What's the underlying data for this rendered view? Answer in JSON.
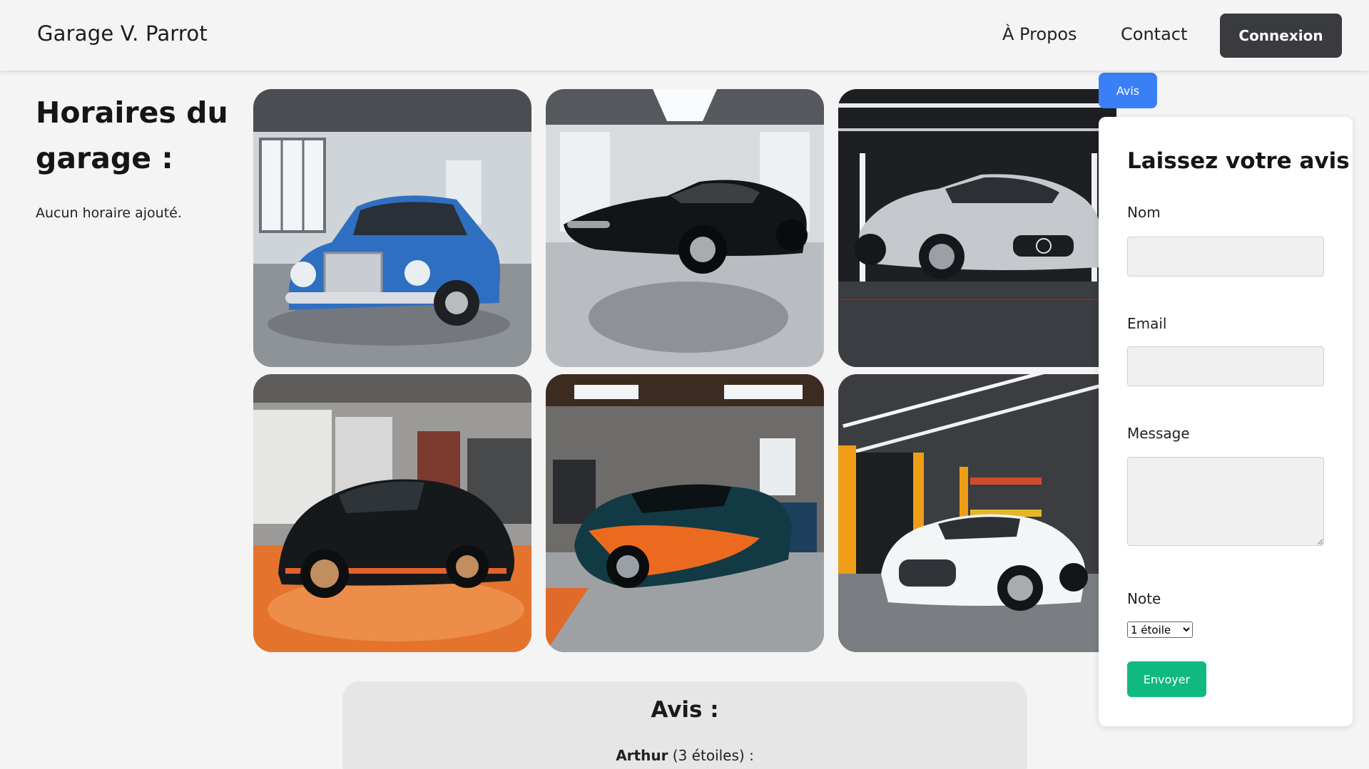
{
  "header": {
    "brand": "Garage V. Parrot",
    "nav": {
      "about": "À Propos",
      "contact": "Contact"
    },
    "login_label": "Connexion"
  },
  "hours": {
    "title": "Horaires du garage :",
    "empty_text": "Aucun horaire ajouté."
  },
  "gallery": {
    "images": [
      {
        "name": "car-image-blue-vintage"
      },
      {
        "name": "car-image-black-classic"
      },
      {
        "name": "car-image-silver-sports"
      },
      {
        "name": "car-image-black-orange-coupe"
      },
      {
        "name": "car-image-orange-teal-supercar"
      },
      {
        "name": "car-image-white-sedan"
      }
    ]
  },
  "reviews": {
    "title": "Avis :",
    "items": [
      {
        "author": "Arthur",
        "rating_text": "(3 étoiles) :"
      }
    ]
  },
  "review_form": {
    "tab_label": "Avis",
    "title": "Laissez votre avis",
    "name_label": "Nom",
    "name_value": "",
    "email_label": "Email",
    "email_value": "",
    "message_label": "Message",
    "message_value": "",
    "rating_label": "Note",
    "rating_selected": "1 étoile",
    "submit_label": "Envoyer"
  },
  "colors": {
    "login_button": "#3a3b3f",
    "tab_blue": "#3a7ff6",
    "submit_green": "#10b981"
  }
}
